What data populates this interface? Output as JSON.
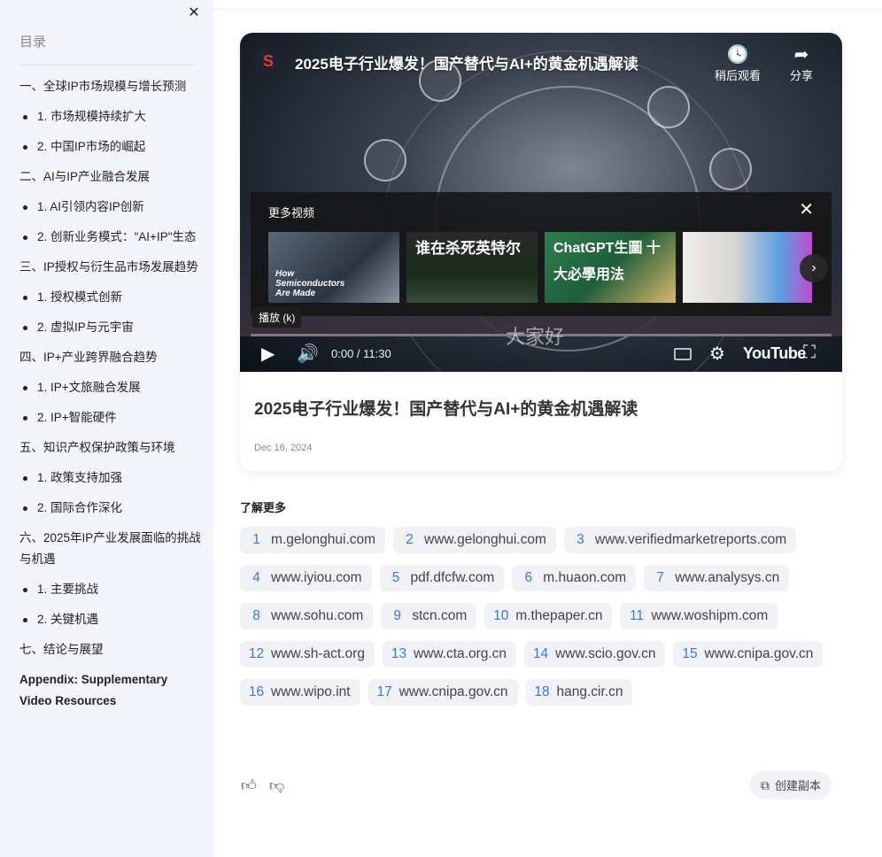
{
  "sidebar": {
    "title": "目录",
    "close_icon": "close-icon",
    "items": [
      {
        "label": "一、全球IP市场规模与增长预测",
        "level": 1
      },
      {
        "label": "1. 市场规模持续扩大",
        "level": 2
      },
      {
        "label": "2. 中国IP市场的崛起",
        "level": 2
      },
      {
        "label": "二、AI与IP产业融合发展",
        "level": 1
      },
      {
        "label": "1. AI引领内容IP创新",
        "level": 2
      },
      {
        "label": "2. 创新业务模式：\"AI+IP\"生态",
        "level": 2
      },
      {
        "label": "三、IP授权与衍生品市场发展趋势",
        "level": 1
      },
      {
        "label": "1. 授权模式创新",
        "level": 2
      },
      {
        "label": "2. 虚拟IP与元宇宙",
        "level": 2
      },
      {
        "label": "四、IP+产业跨界融合趋势",
        "level": 1
      },
      {
        "label": "1. IP+文旅融合发展",
        "level": 2
      },
      {
        "label": "2. IP+智能硬件",
        "level": 2
      },
      {
        "label": "五、知识产权保护政策与环境",
        "level": 1
      },
      {
        "label": "1. 政策支持加强",
        "level": 2
      },
      {
        "label": "2. 国际合作深化",
        "level": 2
      },
      {
        "label": "六、2025年IP产业发展面临的挑战与机遇",
        "level": 1
      },
      {
        "label": "1. 主要挑战",
        "level": 2
      },
      {
        "label": "2. 关键机遇",
        "level": 2
      },
      {
        "label": "七、结论与展望",
        "level": 1
      },
      {
        "label": "Appendix: Supplementary Video Resources",
        "level": 1,
        "bold": true
      }
    ]
  },
  "video": {
    "channel_logo": "S",
    "title": "2025电子行业爆发！国产替代与AI+的黄金机遇解读",
    "watch_later": "稍后观看",
    "share": "分享",
    "more_videos": "更多视频",
    "thumbnails": [
      {
        "text": "How Semiconductors Are Made"
      },
      {
        "text": "谁在杀死英特尔"
      },
      {
        "text": "ChatGPT生圖 十大必學用法"
      },
      {
        "text": ""
      }
    ],
    "play_tooltip": "播放 (k)",
    "time": "0:00 / 11:30",
    "subtitle_overlay": "大家好",
    "youtube_label": "YouTube"
  },
  "card": {
    "title": "2025电子行业爆发！国产替代与AI+的黄金机遇解读",
    "date": "Dec 16, 2024"
  },
  "learn_more": {
    "title": "了解更多",
    "links": [
      {
        "num": "1",
        "domain": "m.gelonghui.com"
      },
      {
        "num": "2",
        "domain": "www.gelonghui.com"
      },
      {
        "num": "3",
        "domain": "www.verifiedmarketreports.com"
      },
      {
        "num": "4",
        "domain": "www.iyiou.com"
      },
      {
        "num": "5",
        "domain": "pdf.dfcfw.com"
      },
      {
        "num": "6",
        "domain": "m.huaon.com"
      },
      {
        "num": "7",
        "domain": "www.analysys.cn"
      },
      {
        "num": "8",
        "domain": "www.sohu.com"
      },
      {
        "num": "9",
        "domain": "stcn.com"
      },
      {
        "num": "10",
        "domain": "m.thepaper.cn"
      },
      {
        "num": "11",
        "domain": "www.woshipm.com"
      },
      {
        "num": "12",
        "domain": "www.sh-act.org"
      },
      {
        "num": "13",
        "domain": "www.cta.org.cn"
      },
      {
        "num": "14",
        "domain": "www.scio.gov.cn"
      },
      {
        "num": "15",
        "domain": "www.cnipa.gov.cn"
      },
      {
        "num": "16",
        "domain": "www.wipo.int"
      },
      {
        "num": "17",
        "domain": "www.cnipa.gov.cn"
      },
      {
        "num": "18",
        "domain": "hang.cir.cn"
      }
    ]
  },
  "actions": {
    "create_copy": "创建副本"
  },
  "colors": {
    "sidebar_bg": "#f4f5fa",
    "chip_bg": "#f1f2f6",
    "link_num": "#3b78d6"
  }
}
